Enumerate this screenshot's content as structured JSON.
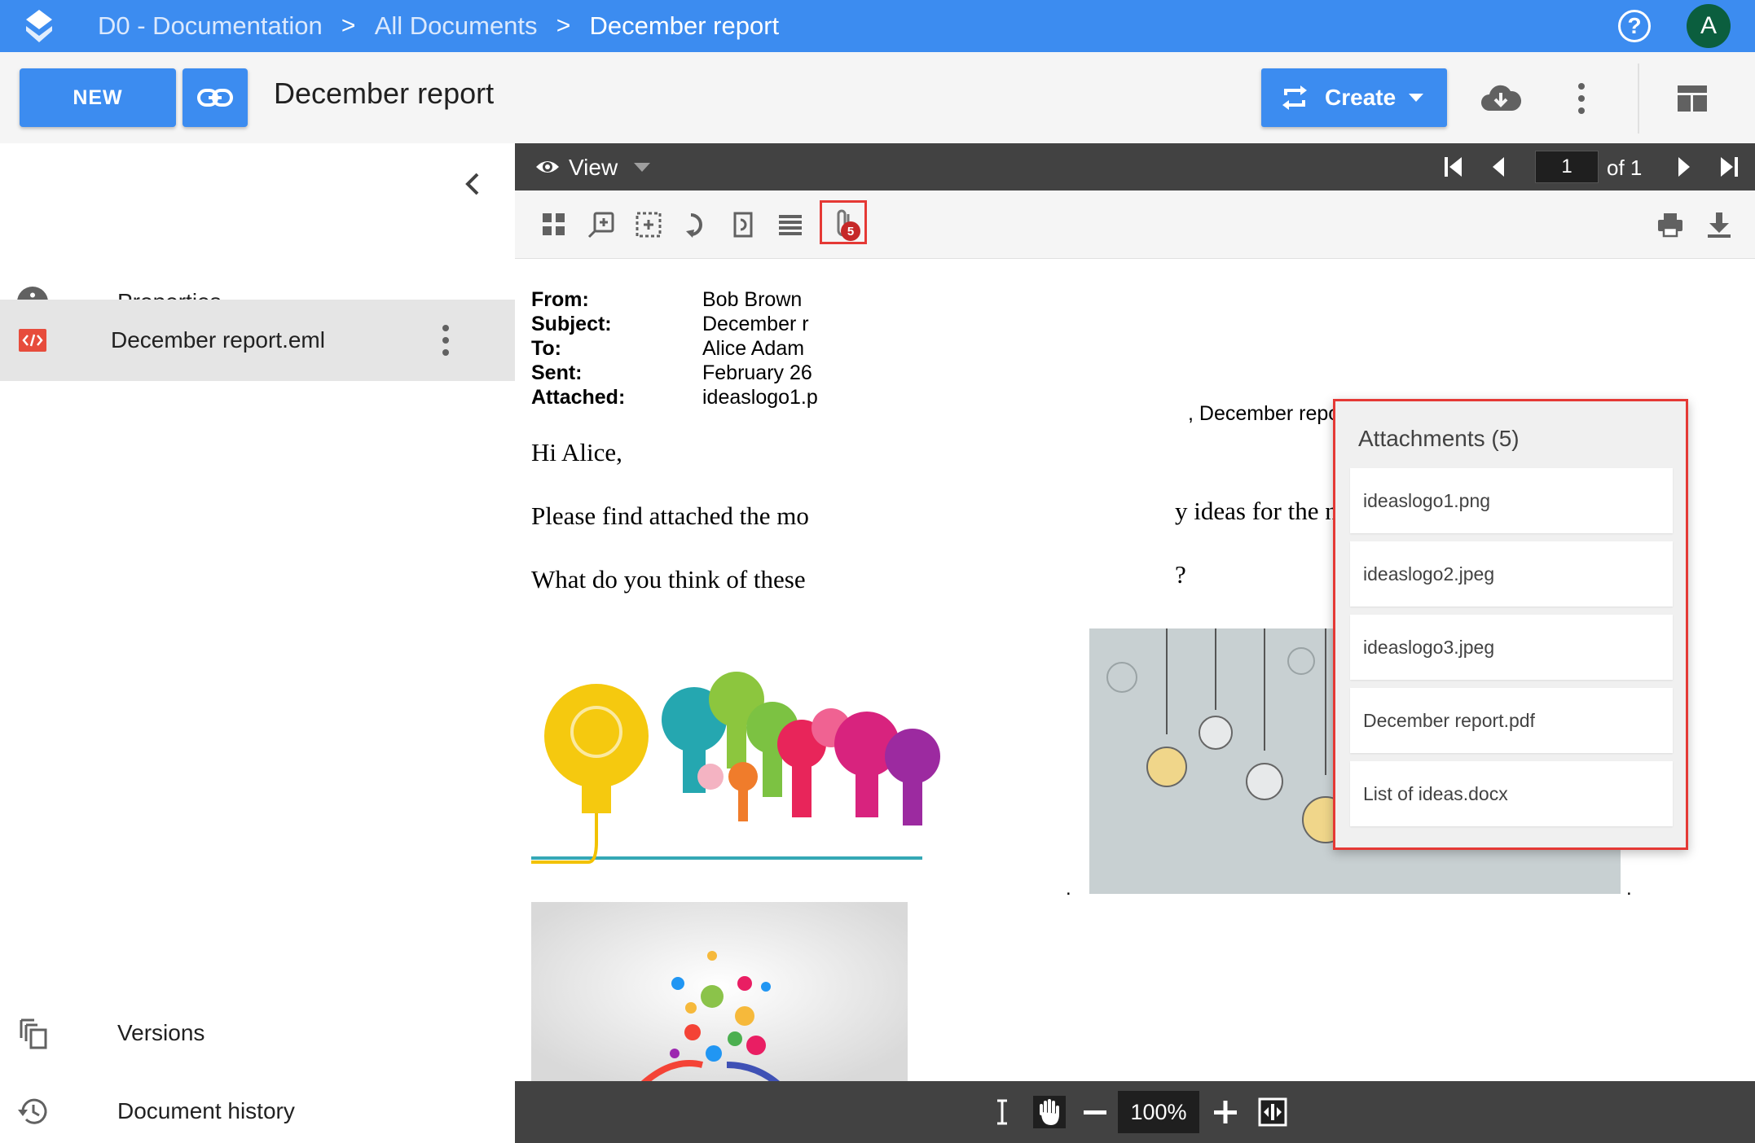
{
  "topbar": {
    "breadcrumb": [
      "D0 - Documentation",
      "All Documents",
      "December report"
    ],
    "separator": ">",
    "help_label": "?",
    "avatar_initial": "A",
    "color": "#3c8cf0"
  },
  "header": {
    "new_label": "NEW",
    "title": "December report",
    "create_label": "Create"
  },
  "sidebar": {
    "properties_label": "Properties",
    "file_label": "December report.eml",
    "versions_label": "Versions",
    "history_label": "Document history"
  },
  "viewer": {
    "view_label": "View",
    "page_current": "1",
    "page_of": "of 1",
    "attachment_count": "5",
    "zoom": "100%"
  },
  "email": {
    "labels": {
      "from": "From:",
      "subject": "Subject:",
      "to": "To:",
      "sent": "Sent:",
      "attached": "Attached:"
    },
    "values": {
      "from": "Bob Brown",
      "subject": "December r",
      "to": "Alice Adam",
      "sent": "February 26",
      "attached": "ideaslogo1.p"
    },
    "attached_tail": ", December report.pdf, List of ideas.docx",
    "greeting": "Hi Alice,",
    "line2_start": "Please find attached the mo",
    "line2_end": "y ideas for the next semester.",
    "line3_start": "What do you think of these",
    "line3_end": "?",
    "image_dot": "."
  },
  "attachments": {
    "title": "Attachments (5)",
    "items": [
      "ideaslogo1.png",
      "ideaslogo2.jpeg",
      "ideaslogo3.jpeg",
      "December report.pdf",
      "List of ideas.docx"
    ]
  }
}
